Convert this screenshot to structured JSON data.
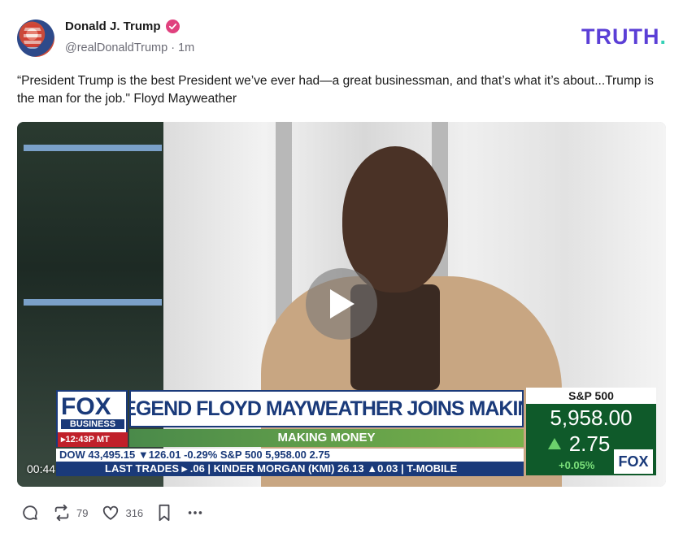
{
  "post": {
    "display_name": "Donald J. Trump",
    "handle": "@realDonaldTrump",
    "separator": "·",
    "time_ago": "1m",
    "text": "“President Trump is the best President we’ve ever had—a great businessman, and that’s what it’s about...Trump is the man for the job.\" Floyd Mayweather"
  },
  "brand": {
    "logo_text": "TRUTH",
    "logo_dot": "."
  },
  "video": {
    "timestamp": "00:44",
    "chyron": {
      "network": "FOX",
      "network_sub": "BUSINESS",
      "time": "▸12:43P MT",
      "headline": "BOXING LEGEND FLOYD MAYWEATHER JOINS MAKING MONEY",
      "show_name": "MAKING MONEY",
      "ticker_top": "DOW    43,495.15 ▼126.01  -0.29%   S&P 500   5,958.00   2.75",
      "ticker_bottom": "LAST TRADES  ▸ .06  |  KINDER MORGAN (KMI)  26.13 ▲0.03  |  T-MOBILE",
      "index_name": "S&P 500",
      "index_value": "5,958.00",
      "index_change": "2.75",
      "index_pct": "+0.05%",
      "logo_small": "FOX"
    }
  },
  "actions": {
    "reply_icon": "reply-icon",
    "repost_count": "79",
    "like_count": "316",
    "bookmark_icon": "bookmark-icon",
    "more_icon": "more-icon"
  },
  "colors": {
    "brand_purple": "#5b3fd6",
    "brand_teal": "#35d1b6",
    "verified_pink": "#e0417e"
  }
}
